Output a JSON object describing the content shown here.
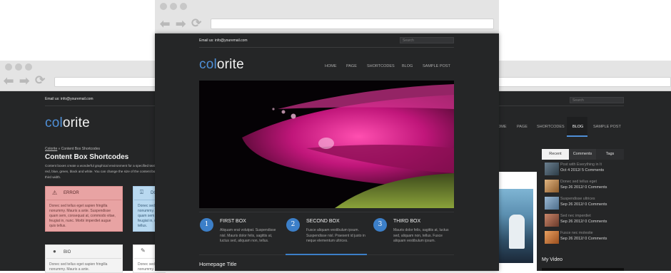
{
  "left": {
    "email": "Email us: info@youremail.com",
    "logo_col": "col",
    "logo_orite": "orite",
    "breadcrumb_home": "Colorite",
    "breadcrumb_sep": "»",
    "breadcrumb_current": "Content Box Shortcodes",
    "page_title": "Content Box Shortcodes",
    "intro_line1": "Content boxes create a wonderful graphical environment for a specified text",
    "intro_line2": "red, blue, green, black and white. You can change the size of the content bo",
    "intro_line3": "third width.",
    "boxes": [
      {
        "title": "ERROR",
        "icon": "warning-icon",
        "text": "Donec sed tellus eget sapien fringilla nonummy. Mauris a ante. Suspendisse quam sem, consequat at, commodo vitae, feugiat in, nunc. Morbi imperdiet augue quis tellus."
      },
      {
        "title": "DO",
        "icon": "download-icon",
        "text": "Donec sed tel nonummy. Ma quam sem, co feugiat in, nu quis tellus."
      },
      {
        "title": "BIO",
        "icon": "person-icon",
        "text": "Donec sed tellus eget sapien fringilla nonummy. Mauris a ante."
      },
      {
        "title": "",
        "icon": "paperclip-icon",
        "text": "Donec sed te nonummy. Ma"
      }
    ]
  },
  "center": {
    "email": "Email us: info@youremail.com",
    "search_placeholder": "Search",
    "logo_col": "col",
    "logo_orite": "orite",
    "nav": [
      "HOME",
      "PAGE",
      "SHORTCODES",
      "BLOG",
      "SAMPLE POST"
    ],
    "boxes": [
      {
        "num": "1",
        "title": "FIRST BOX",
        "text": "Aliquam erat volutpat. Suspendisse nisl. Mauris dolor felis, sagittis at, luctus sed, aliquam non, tellus."
      },
      {
        "num": "2",
        "title": "SECOND BOX",
        "text": "Fusce aliquam vestibulum ipsum. Suspendisse nisl. Praesent id justo in neque elementum ultrices."
      },
      {
        "num": "3",
        "title": "THIRD BOX",
        "text": "Mauris dolor felis, sagittis at, luctus sed, aliquam non, tellus. Fusce aliquam vestibulum ipsum."
      }
    ],
    "homepage_title": "Homepage Title"
  },
  "right": {
    "search_placeholder": "Search",
    "nav": [
      "OME",
      "PAGE",
      "SHORTCODES",
      "BLOG",
      "SAMPLE POST"
    ],
    "tabs": [
      "Recent",
      "Comments",
      "Tags"
    ],
    "posts": [
      {
        "title": "Post with Everything in It",
        "meta": "Oct 4 2012/ 5 Comments"
      },
      {
        "title": "Donec sed tellus eget",
        "meta": "Sep 26 2012/ 0 Comments"
      },
      {
        "title": "Suspendisse ultrices",
        "meta": "Sep 26 2012/ 0 Comments"
      },
      {
        "title": "Sed nec imperdiet",
        "meta": "Sep 26 2012/ 0 Comments"
      },
      {
        "title": "Fusce nec molestie",
        "meta": "Sep 26 2012/ 0 Comments"
      }
    ],
    "my_video": "My Video"
  },
  "colors": {
    "accent": "#4f8fd6",
    "dark_bg": "#252627",
    "error_box": "#e8a3a3",
    "info_box": "#b9d9f0"
  }
}
